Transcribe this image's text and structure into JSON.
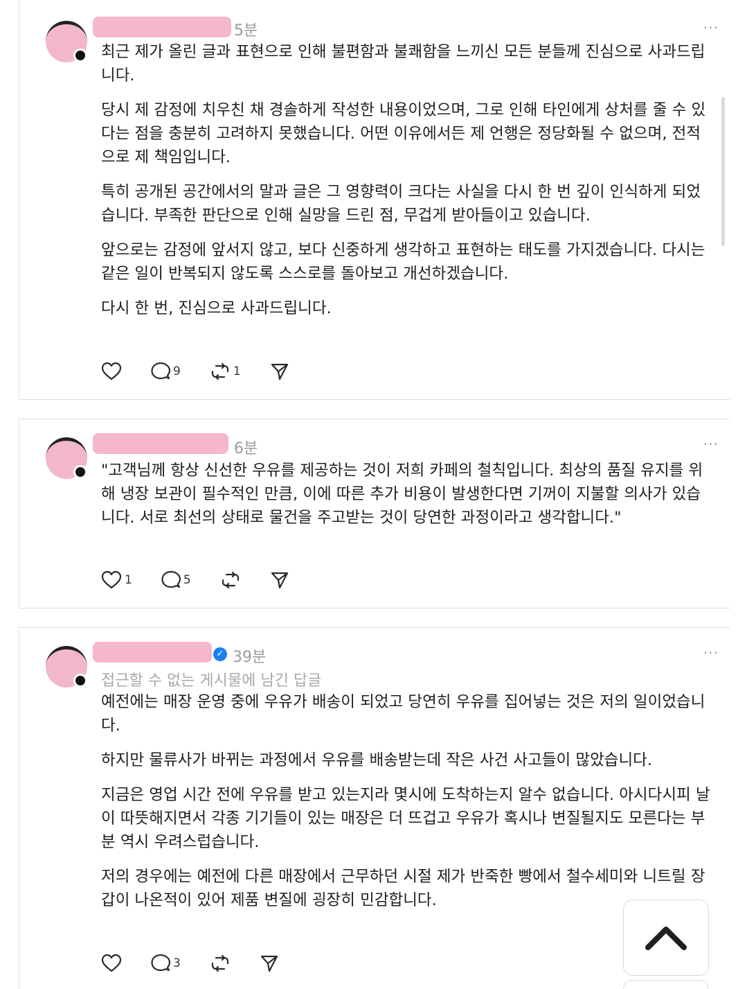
{
  "posts": [
    {
      "timestamp": "5분",
      "more": "···",
      "paragraphs": [
        "최근 제가 올린 글과 표현으로 인해 불편함과 불쾌함을 느끼신 모든 분들께 진심으로 사과드립니다.",
        "당시 제 감정에 치우친 채 경솔하게 작성한 내용이었으며, 그로 인해 타인에게 상처를 줄 수 있다는 점을 충분히 고려하지 못했습니다. 어떤 이유에서든 제 언행은 정당화될 수 없으며, 전적으로 제 책임입니다.",
        "특히 공개된 공간에서의 말과 글은 그 영향력이 크다는 사실을 다시 한 번 깊이 인식하게 되었습니다. 부족한 판단으로 인해 실망을 드린 점, 무겁게 받아들이고 있습니다.",
        "앞으로는 감정에 앞서지 않고, 보다 신중하게 생각하고 표현하는 태도를 가지겠습니다. 다시는 같은 일이 반복되지 않도록 스스로를 돌아보고 개선하겠습니다.",
        "다시 한 번, 진심으로 사과드립니다."
      ],
      "reply_count": "9",
      "repost_count": "1"
    },
    {
      "timestamp": "6분",
      "more": "···",
      "paragraphs": [
        "\"고객님께 항상 신선한 우유를 제공하는 것이 저희 카페의 철칙입니다. 최상의 품질 유지를 위해 냉장 보관이 필수적인 만큼, 이에 따른 추가 비용이 발생한다면 기꺼이 지불할 의사가 있습니다. 서로 최선의 상태로 물건을 주고받는 것이 당연한 과정이라고 생각합니다.\""
      ],
      "like_count": "1",
      "reply_count": "5"
    },
    {
      "timestamp": "39분",
      "more": "···",
      "reply_note": "접근할 수 없는 게시물에 남긴 답글",
      "paragraphs": [
        "예전에는 매장 운영 중에 우유가 배송이 되었고 당연히 우유를 집어넣는 것은 저의 일이었습니다.",
        "하지만 물류사가 바뀌는 과정에서 우유를 배송받는데 작은 사건 사고들이 많았습니다.",
        "지금은 영업 시간 전에 우유를 받고 있는지라 몇시에 도착하는지 알수 없습니다. 아시다시피 날이 따뜻해지면서 각종 기기들이 있는 매장은 더 뜨겁고 우유가 혹시나 변질될지도 모른다는 부분 역시 우려스럽습니다.",
        "저의 경우에는 예전에 다른 매장에서 근무하던 시절 제가 반죽한 빵에서 철수세미와 니트릴 장갑이 나온적이 있어 제품 변질에 굉장히 민감합니다."
      ],
      "reply_count": "3"
    }
  ],
  "icons": {
    "like": "heart-icon",
    "reply": "speech-bubble-icon",
    "repost": "repost-icon",
    "share": "send-icon",
    "verified": "verified-badge-icon",
    "scroll_top": "chevron-up-icon"
  },
  "colors": {
    "username_blur": "#f4b7cc",
    "verified": "#1d7ff0",
    "muted_text": "#9a9a9a"
  }
}
